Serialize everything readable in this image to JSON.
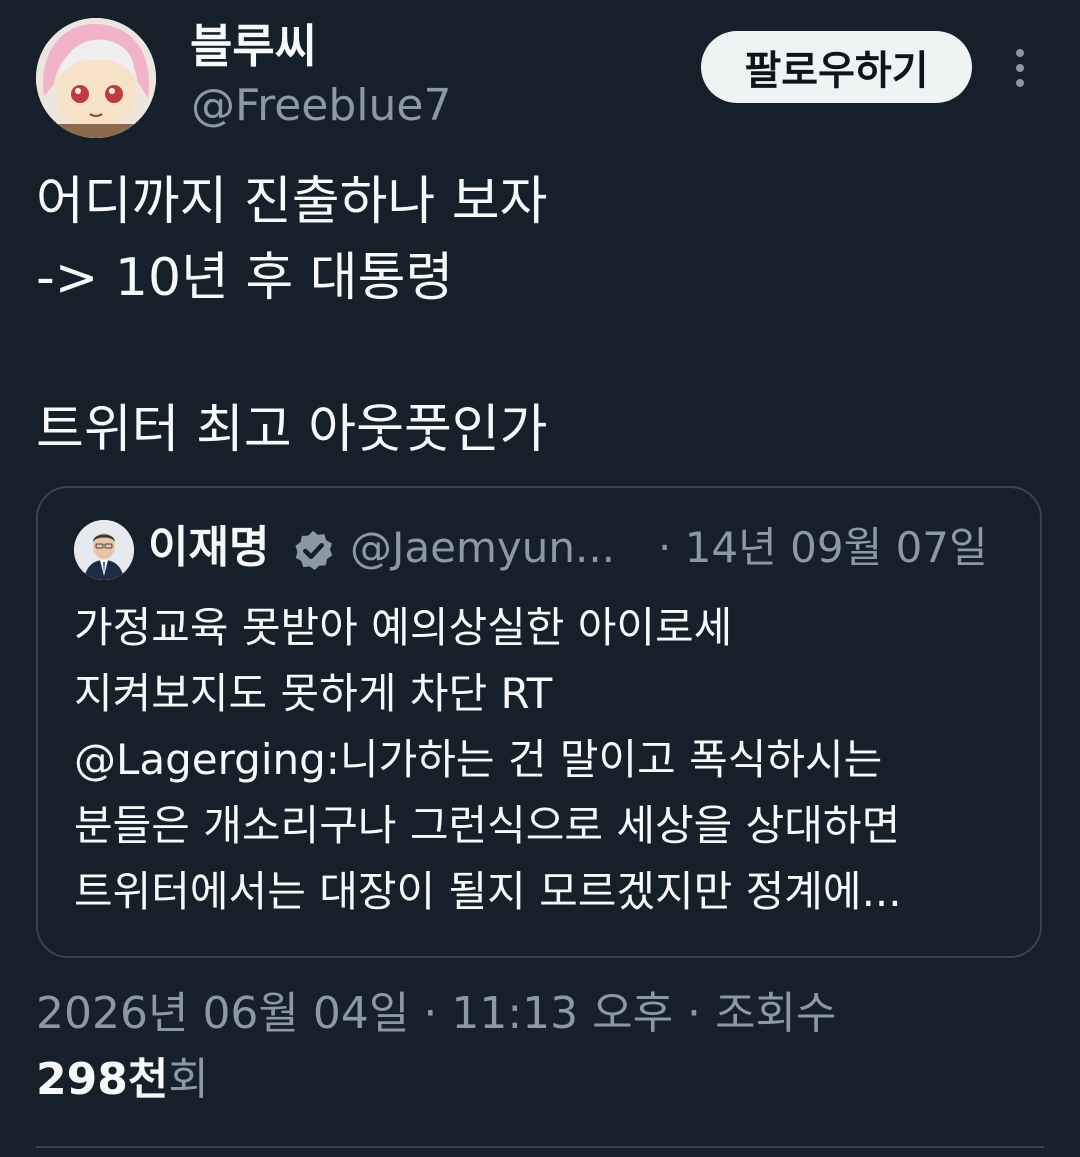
{
  "author": {
    "display_name": "블루씨",
    "handle": "@Freeblue7",
    "avatar": "anime-girl-avatar"
  },
  "follow_button": {
    "label": "팔로우하기"
  },
  "more_icon": "more-vertical-icon",
  "tweet": {
    "lines": [
      "어디까지 진출하나 보자",
      "-> 10년 후 대통령",
      "트위터 최고 아웃풋인가"
    ]
  },
  "quoted_tweet": {
    "display_name": "이재명",
    "verified_icon": "verified-badge-icon",
    "handle": "@Jaemyun...",
    "date": "· 14년 09월 07일",
    "lines": [
      "가정교육 못받아 예의상실한 아이로세",
      "지켜보지도 못하게 차단 RT",
      "@Lagerging:니가하는 건 말이고 폭식하시는",
      "분들은 개소리구나 그런식으로 세상을 상대하면",
      "트위터에서는 대장이 될지 모르겠지만 정계에..."
    ]
  },
  "meta": {
    "timestamp_line": "2026년 06월 04일 · 11:13 오후 · 조회수",
    "views_count": "298천",
    "views_unit": "회"
  },
  "colors": {
    "background": "#15202b",
    "text": "#f7f9f9",
    "secondary_text": "#8b98a5",
    "border": "#38444d",
    "follow_button_bg": "#eff3f4"
  }
}
